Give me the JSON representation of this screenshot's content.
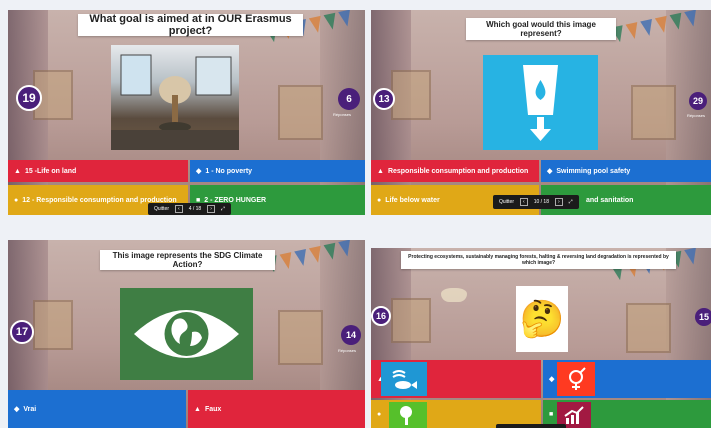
{
  "quiz1": {
    "question": "What goal is aimed at in OUR Erasmus project?",
    "timer": "19",
    "answers_count": "6",
    "answers_label": "Réponses",
    "options": [
      "15 -Life on land",
      "1 - No poverty",
      "12 - Responsible consumption and production",
      "2 - ZERO HUNGER"
    ],
    "toolbar": {
      "quit": "Quitter",
      "page": "4 / 18"
    }
  },
  "quiz2": {
    "question": "Which goal would this image represent?",
    "timer": "13",
    "answers_count": "29",
    "answers_label": "Réponses",
    "options": [
      "Responsible consumption and production",
      "Swimming pool safety",
      "Life below water",
      "and sanitation"
    ],
    "toolbar": {
      "quit": "Quitter",
      "page": "10 / 18"
    }
  },
  "quiz3": {
    "question": "This image represents the SDG Climate Action?",
    "timer": "17",
    "answers_count": "14",
    "answers_label": "Réponses",
    "options": [
      "Vrai",
      "Faux"
    ]
  },
  "quiz4": {
    "question": "Protecting ecosystems, sustainably managing forests, halting & reversing land degradation is represented by which image?",
    "timer": "16",
    "answers_count": "15",
    "emoji": "🤔"
  },
  "colors": {
    "red": "#e0253c",
    "blue": "#1c6fd1",
    "yellow": "#e0a817",
    "green": "#2d9a3d",
    "timer": "#4a1f7a"
  }
}
